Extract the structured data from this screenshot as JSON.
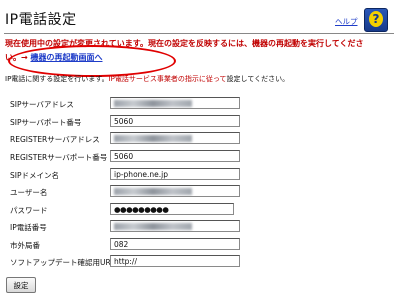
{
  "header": {
    "title": "IP電話設定",
    "help_label": "ヘルプ",
    "help_icon": "help-question-icon"
  },
  "warning": {
    "line1": "現在使用中の設定が変更されています。現在の設定を反映するには、機器の再起動を実行してくださ",
    "line2_prefix": "い。→",
    "reboot_link": "機器の再起動画面へ",
    "color": "#c00000"
  },
  "intro": {
    "before": "IP電話に関する設定を行います。",
    "highlight": "IP電話サービス事業者の指示に従って",
    "after": "設定してください。"
  },
  "form": {
    "fields": [
      {
        "label": "SIPサーバアドレス",
        "value": ""
      },
      {
        "label": "SIPサーバポート番号",
        "value": "5060"
      },
      {
        "label": "REGISTERサーバアドレス",
        "value": ""
      },
      {
        "label": "REGISTERサーバポート番号",
        "value": "5060"
      },
      {
        "label": "SIPドメイン名",
        "value": "ip-phone.ne.jp"
      },
      {
        "label": "ユーザー名",
        "value": ""
      },
      {
        "label": "パスワード",
        "value": "●●●●●●●●●"
      },
      {
        "label": "IP電話番号",
        "value": ""
      },
      {
        "label": "市外局番",
        "value": "082"
      },
      {
        "label": "ソフトアップデート確認用URL",
        "value": "http://"
      }
    ],
    "submit_label": "設定"
  }
}
